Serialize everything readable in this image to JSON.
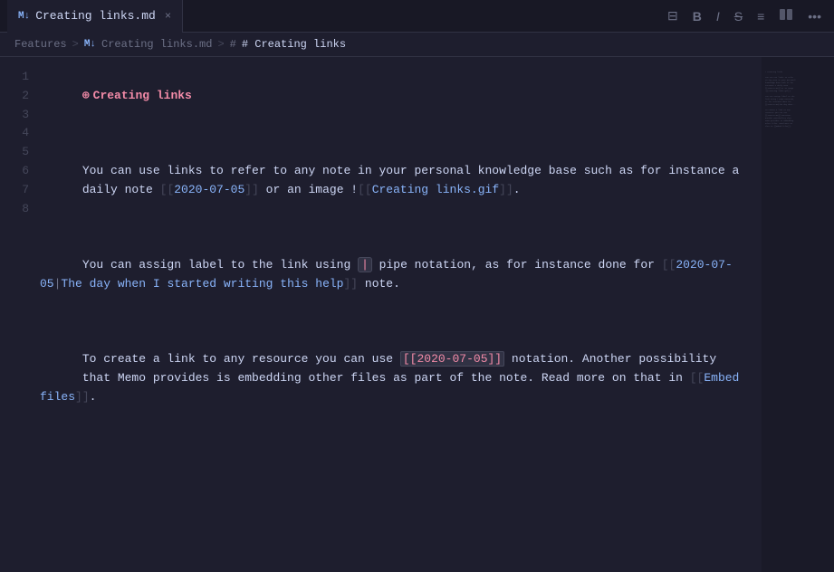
{
  "tab": {
    "icon": "M↓",
    "label": "Creating links.md",
    "close": "×"
  },
  "toolbar": {
    "split_icon": "⊟",
    "bold_icon": "B",
    "italic_icon": "I",
    "strikethrough_icon": "S",
    "list_icon": "≡",
    "columns_icon": "⊞",
    "more_icon": "•••"
  },
  "breadcrumb": {
    "features": "Features",
    "sep1": ">",
    "md_icon": "M↓",
    "file": "Creating links.md",
    "sep2": ">",
    "hash_icon": "#",
    "section": "# Creating links"
  },
  "line_numbers": [
    "1",
    "2",
    "3",
    "4",
    "5",
    "6",
    "7",
    "8"
  ],
  "lines": {
    "line1_heading_icon": "⊕",
    "line1_text": "Creating links",
    "line3_part1": "You can use links to refer to any note in your personal knowledge base such as for instance a",
    "line3_part2": "daily note ",
    "line3_link1": "2020-07-05",
    "line3_part3": " or an image !",
    "line3_link2": "Creating links.gif",
    "line5_part1": "You can assign label to the link using ",
    "line5_pipe": "|",
    "line5_part2": " pipe notation, as for instance done for ",
    "line5_link3_date": "2020-07-05",
    "line5_link3_label": "The day when I started writing this help",
    "line5_part3": " note.",
    "line7_part1": "To create a link to any resource you can use ",
    "line7_code": "[[2020-07-05]]",
    "line7_part2": " notation. Another possibility",
    "line7_part3": "that Memo provides is embedding other files as part of the note. Read more on that in ",
    "line7_link4": "Embed files",
    "line7_part4": "."
  }
}
